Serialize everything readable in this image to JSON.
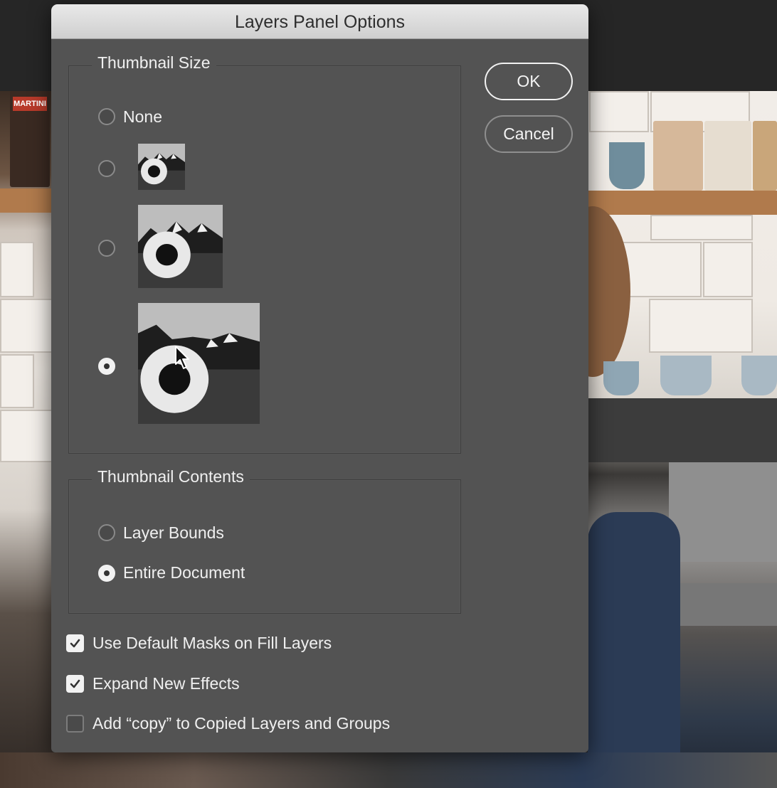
{
  "dialog": {
    "title": "Layers Panel Options",
    "thumbnail_size": {
      "label": "Thumbnail Size",
      "options": [
        {
          "label": "None",
          "selected": false
        },
        {
          "label": "",
          "size": "small",
          "selected": false
        },
        {
          "label": "",
          "size": "medium",
          "selected": false
        },
        {
          "label": "",
          "size": "large",
          "selected": true
        }
      ]
    },
    "thumbnail_contents": {
      "label": "Thumbnail Contents",
      "options": [
        {
          "label": "Layer Bounds",
          "selected": false
        },
        {
          "label": "Entire Document",
          "selected": true
        }
      ]
    },
    "checkboxes": [
      {
        "label": "Use Default Masks on Fill Layers",
        "checked": true
      },
      {
        "label": "Expand New Effects",
        "checked": true
      },
      {
        "label": "Add “copy” to Copied Layers and Groups",
        "checked": false
      }
    ],
    "buttons": {
      "ok": "OK",
      "cancel": "Cancel"
    }
  },
  "icons": {
    "cursor": "arrow-cursor-icon",
    "thumbnail": "sunflower-image-icon"
  },
  "background": {
    "photo_label": "MARTINI"
  },
  "colors": {
    "dialog_bg": "#535353",
    "titlebar": "#dcdcdc",
    "text": "#f0f0f0"
  }
}
